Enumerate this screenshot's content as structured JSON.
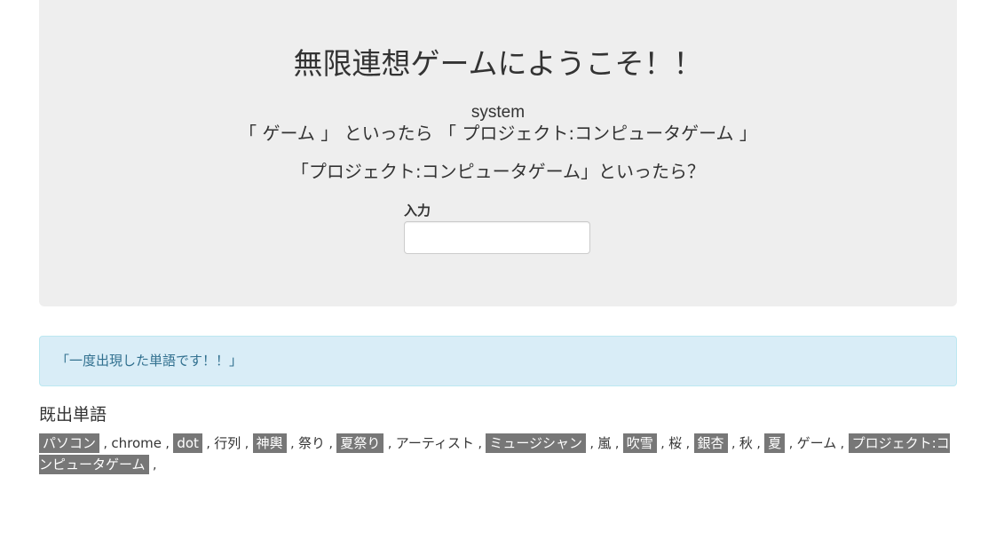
{
  "header": {
    "title": "無限連想ゲームにようこそ！！",
    "speaker": "system",
    "statement": "「 ゲーム 」 といったら 「 プロジェクト:コンピュータゲーム 」",
    "question": "「プロジェクト:コンピュータゲーム」といったら？"
  },
  "form": {
    "input_label": "入力",
    "input_value": "",
    "input_placeholder": ""
  },
  "alert": {
    "message": "「一度出現した単語です！！」"
  },
  "used_words": {
    "heading": "既出単語",
    "separator": ",",
    "items": [
      {
        "text": "パソコン",
        "highlighted": true
      },
      {
        "text": "chrome",
        "highlighted": false
      },
      {
        "text": "dot",
        "highlighted": true
      },
      {
        "text": "行列",
        "highlighted": false
      },
      {
        "text": "神輿",
        "highlighted": true
      },
      {
        "text": "祭り",
        "highlighted": false
      },
      {
        "text": "夏祭り",
        "highlighted": true
      },
      {
        "text": "アーティスト",
        "highlighted": false
      },
      {
        "text": "ミュージシャン",
        "highlighted": true
      },
      {
        "text": "嵐",
        "highlighted": false
      },
      {
        "text": "吹雪",
        "highlighted": true
      },
      {
        "text": "桜",
        "highlighted": false
      },
      {
        "text": "銀杏",
        "highlighted": true
      },
      {
        "text": "秋",
        "highlighted": false
      },
      {
        "text": "夏",
        "highlighted": true
      },
      {
        "text": "ゲーム",
        "highlighted": false
      },
      {
        "text": "プロジェクト:コンピュータゲーム",
        "highlighted": true
      }
    ]
  },
  "colors": {
    "jumbotron_bg": "#eeeeee",
    "alert_bg": "#d9edf7",
    "alert_text": "#31708f",
    "highlight_bg": "#777777"
  }
}
